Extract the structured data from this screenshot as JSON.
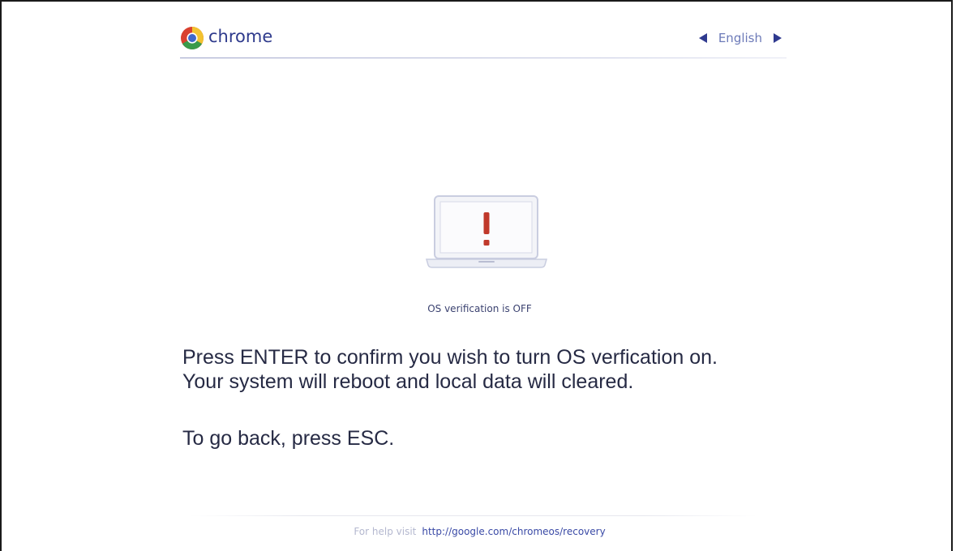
{
  "header": {
    "brand": "chrome",
    "language": "English",
    "logo_icon": "chrome-logo-icon",
    "prev_icon": "triangle-left-icon",
    "next_icon": "triangle-right-icon"
  },
  "illustration": {
    "icon": "laptop-warning-icon",
    "accent_color": "#c0392b"
  },
  "status": {
    "text": "OS verification is OFF"
  },
  "message": {
    "line1": "Press ENTER to confirm you wish to turn OS verfication on.",
    "line2": "Your system will reboot and local data will cleared.",
    "line3": "To go back, press ESC."
  },
  "footer": {
    "help_label": "For help visit",
    "help_link": "http://google.com/chromeos/recovery"
  }
}
